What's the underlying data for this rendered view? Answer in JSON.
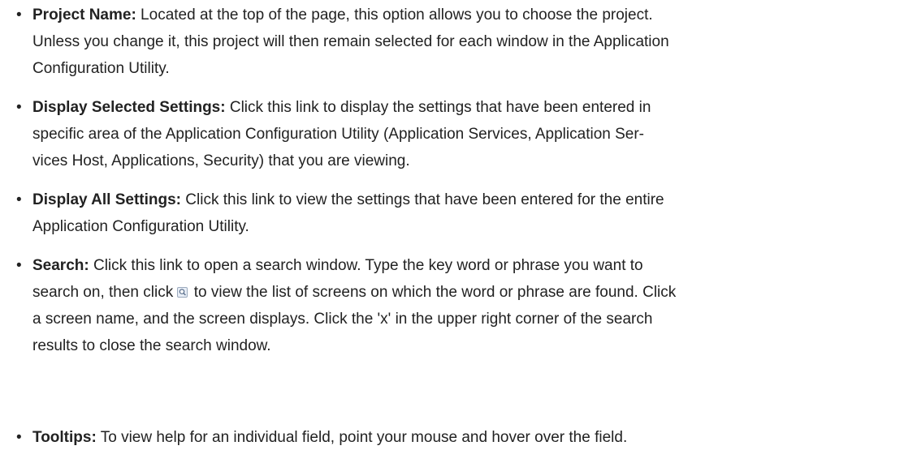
{
  "bullet_char": "•",
  "items": [
    {
      "term": "Project Name:",
      "lines": [
        " Located at the top of the page, this option allows you to choose the project.",
        "Unless you change it, this project will then remain selected for each window in the Application",
        "Configuration Utility."
      ]
    },
    {
      "term": "Display Selected Settings:",
      "lines": [
        " Click this link to display the settings that have been entered in",
        "specific area of the Application Configuration Utility (Application Services, Application Ser-",
        "vices Host, Applications, Security) that you are viewing."
      ]
    },
    {
      "term": "Display All Settings:",
      "lines": [
        " Click this link to view the settings that have been entered for the entire",
        "Application Configuration Utility."
      ]
    },
    {
      "term": "Search:",
      "lines": [
        " Click this link to open a search window. Type the key word or phrase you want to",
        "search on, then click ",
        " to view the list of screens on which the word or phrase are found. Click",
        "a screen name, and the screen displays. Click the 'x' in the upper right corner of the search",
        "results to close the search window."
      ]
    },
    {
      "term": "Tooltips:",
      "lines": [
        " To view help for an individual field, point your mouse and hover over the field."
      ]
    }
  ],
  "icons": {
    "search_button": "search-button-icon"
  }
}
